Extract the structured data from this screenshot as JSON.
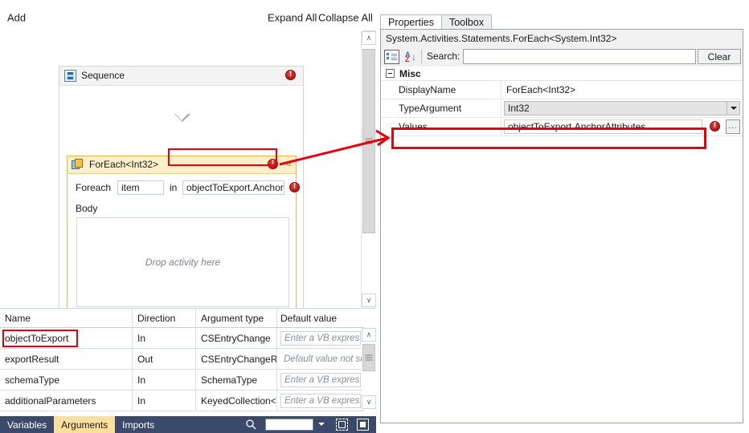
{
  "designer": {
    "toolbar": {
      "add_label": "Add",
      "expand_all_label": "Expand All",
      "collapse_all_label": "Collapse All"
    },
    "sequence": {
      "title": "Sequence",
      "icon": "sequence-icon",
      "error_icon": "error-icon"
    },
    "foreach": {
      "title": "ForEach<Int32>",
      "icon": "foreach-icon",
      "error_icon": "error-icon",
      "collapse_glyph": "«",
      "foreach_label": "Foreach",
      "variable_value": "item",
      "in_label": "in",
      "values_value": "objectToExport.Anchor",
      "values_error_icon": "error-icon",
      "body_label": "Body",
      "drop_hint": "Drop activity here"
    },
    "scrollbar": {
      "up_glyph": "∧",
      "down_glyph": "∨"
    }
  },
  "arguments_grid": {
    "columns": [
      "Name",
      "Direction",
      "Argument type",
      "Default value"
    ],
    "rows": [
      {
        "name": "objectToExport",
        "direction": "In",
        "type": "CSEntryChange",
        "default_value": "Enter a VB express",
        "default_boxed": true
      },
      {
        "name": "exportResult",
        "direction": "Out",
        "type": "CSEntryChangeRe:",
        "default_value": "Default value not su",
        "default_boxed": false
      },
      {
        "name": "schemaType",
        "direction": "In",
        "type": "SchemaType",
        "default_value": "Enter a VB express",
        "default_boxed": true
      },
      {
        "name": "additionalParameters",
        "direction": "In",
        "type": "KeyedCollection<S",
        "default_value": "Enter a VB express",
        "default_boxed": true
      }
    ],
    "scrollbar": {
      "up_glyph": "∧",
      "down_glyph": "∨"
    }
  },
  "status_bar": {
    "tabs": [
      {
        "label": "Variables",
        "active": false
      },
      {
        "label": "Arguments",
        "active": true
      },
      {
        "label": "Imports",
        "active": false
      }
    ],
    "search_icon": "search-icon",
    "combo_value": "",
    "expand_icon": "expand-overview-icon",
    "collapse_icon": "fit-to-screen-icon"
  },
  "properties": {
    "tabs": [
      {
        "label": "Properties",
        "active": true
      },
      {
        "label": "Toolbox",
        "active": false
      }
    ],
    "type_name": "System.Activities.Statements.ForEach<System.Int32>",
    "toolbar": {
      "categorized_icon": "categorized-view-icon",
      "sort_icon": "sort-alphabetical-icon",
      "search_label": "Search:",
      "search_value": "",
      "clear_label": "Clear"
    },
    "category": {
      "label": "Misc",
      "expander_icon": "collapse-box-icon"
    },
    "rows": [
      {
        "name": "DisplayName",
        "value": "ForEach<Int32>",
        "style": "plain"
      },
      {
        "name": "TypeArgument",
        "value": "Int32",
        "style": "combo"
      },
      {
        "name": "Values",
        "value": "objectToExport.AnchorAttributes",
        "style": "editor",
        "error_icon": "error-icon",
        "ellipsis_label": "..."
      }
    ]
  },
  "annotations": {
    "accent_color": "#e8000d",
    "highlight_foreach_values": "objectToExport.Anchor",
    "highlight_properties_values": "Values",
    "highlight_argument_name": "objectToExport"
  }
}
